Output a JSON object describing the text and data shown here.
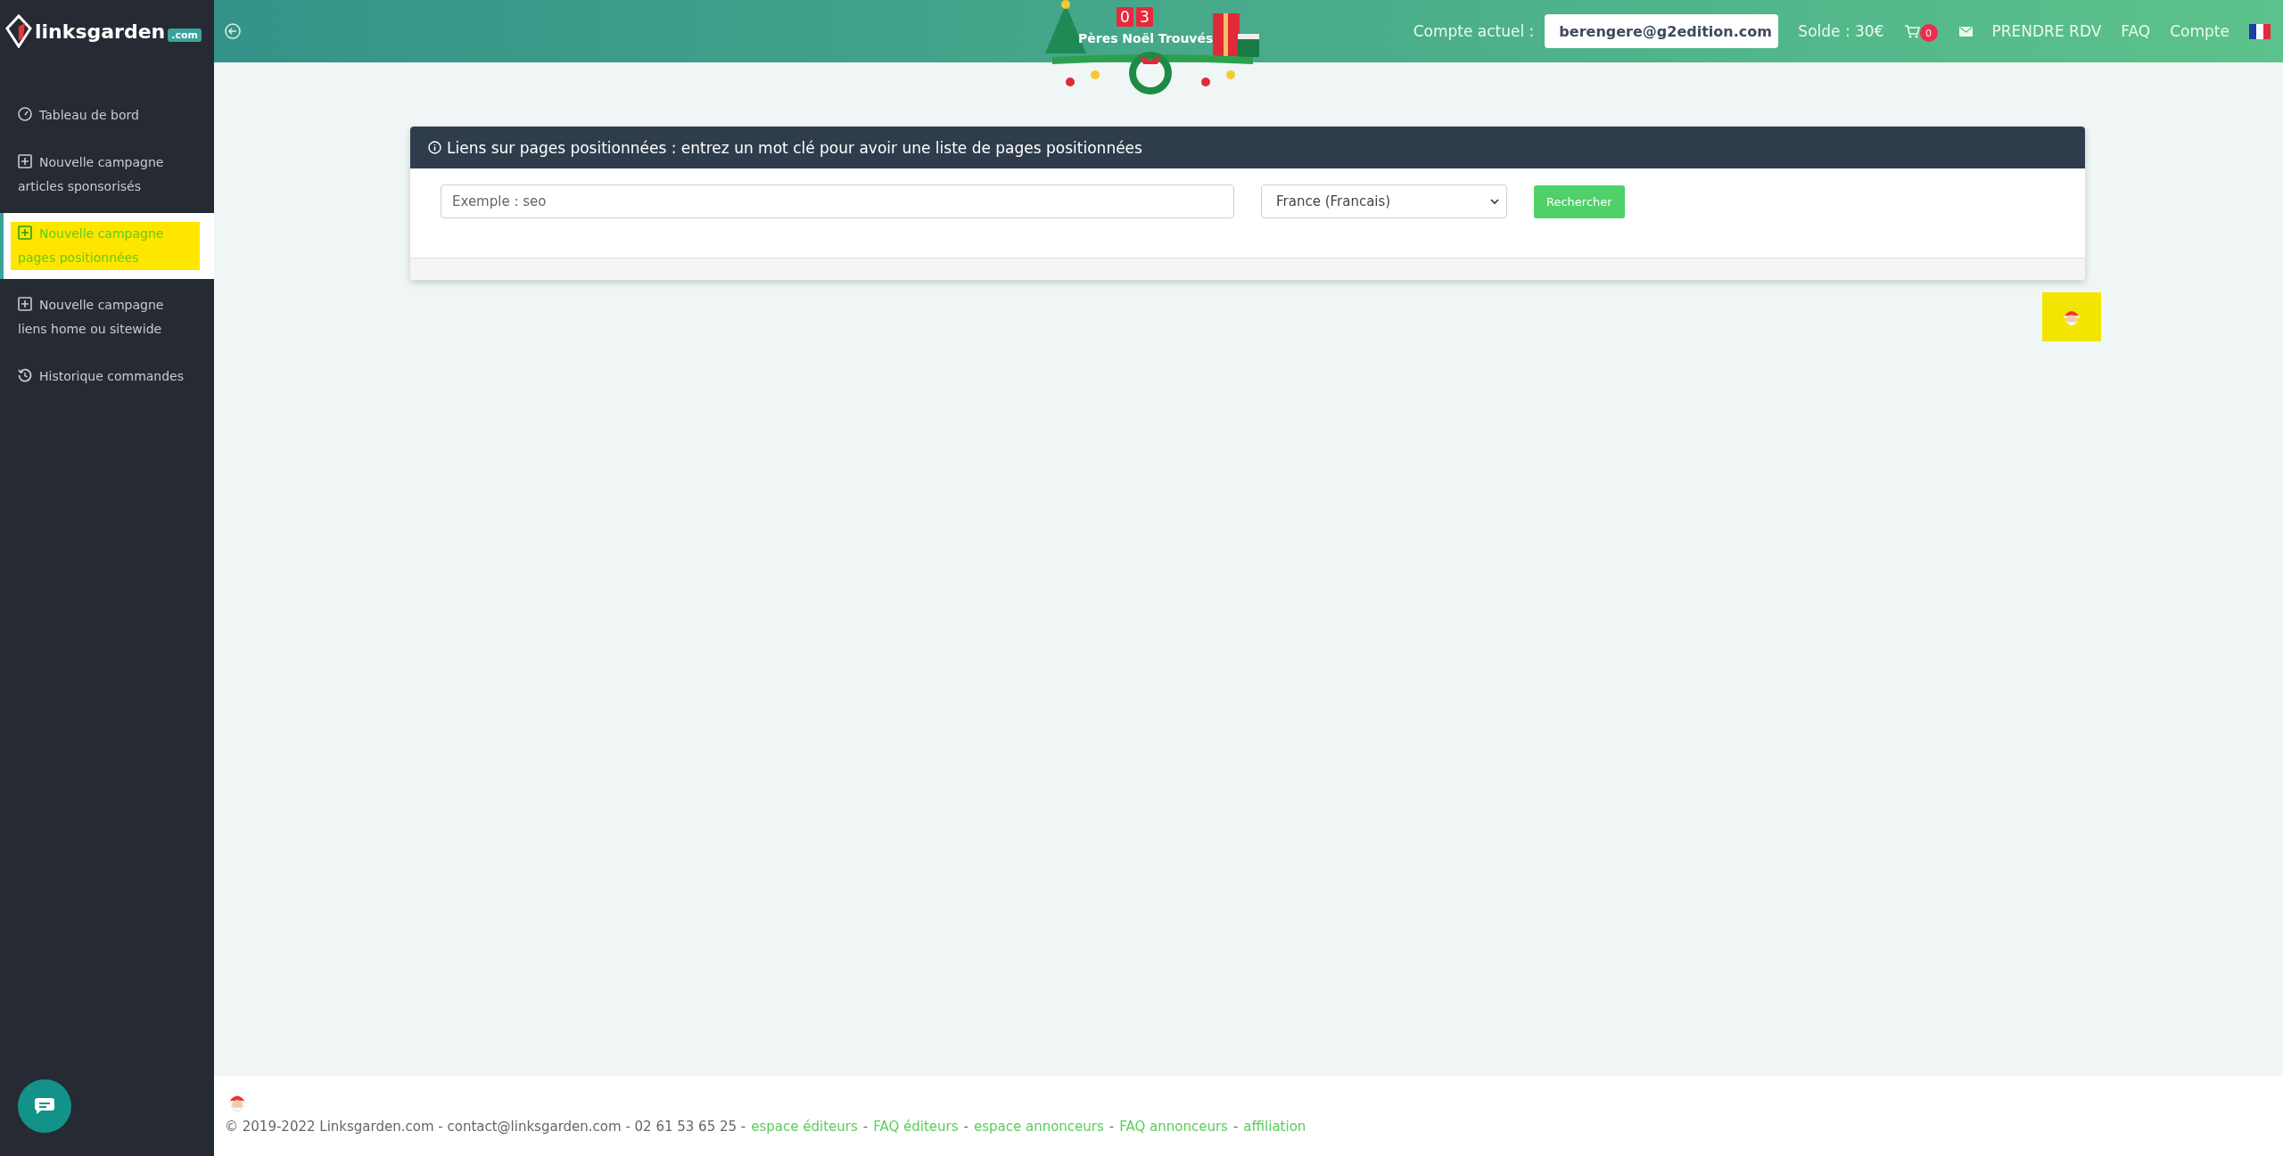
{
  "brand": {
    "name": "linksgarden",
    "tld": ".com"
  },
  "banner": {
    "digits": [
      "0",
      "3"
    ],
    "caption": "Pères Noël Trouvés"
  },
  "header": {
    "account_label": "Compte actuel :",
    "account_value": "berengere@g2edition.com",
    "balance": "Solde : 30€",
    "cart_count": "0",
    "links": [
      "PRENDRE RDV",
      "FAQ",
      "Compte"
    ]
  },
  "sidebar": {
    "items": [
      {
        "kind": "dashboard",
        "lines": [
          "Tableau de bord"
        ],
        "selected": false
      },
      {
        "kind": "create",
        "lines": [
          "Nouvelle campagne",
          "articles sponsorisés"
        ],
        "selected": false
      },
      {
        "kind": "create",
        "lines": [
          "Nouvelle campagne",
          "pages positionnées"
        ],
        "selected": true
      },
      {
        "kind": "create",
        "lines": [
          "Nouvelle campagne",
          "liens home ou sitewide"
        ],
        "selected": false
      },
      {
        "kind": "history",
        "lines": [
          "Historique commandes"
        ],
        "selected": false
      }
    ]
  },
  "card": {
    "title": "Liens sur pages positionnées : entrez un mot clé pour avoir une liste de pages positionnées",
    "keyword": {
      "placeholder": "Exemple : seo"
    },
    "country": "France (Francais)",
    "button": "Rechercher"
  },
  "footer": [
    {
      "kind": "text",
      "text": "© 2019-2022 Linksgarden.com - contact@linksgarden.com - 02 61 53 65 25 -"
    },
    {
      "kind": "link",
      "text": "espace éditeurs"
    },
    {
      "kind": "text",
      "text": "-"
    },
    {
      "kind": "link",
      "text": "FAQ éditeurs"
    },
    {
      "kind": "text",
      "text": "-"
    },
    {
      "kind": "link",
      "text": "espace annonceurs"
    },
    {
      "kind": "text",
      "text": "-"
    },
    {
      "kind": "link",
      "text": "FAQ annonceurs"
    },
    {
      "kind": "text",
      "text": "-"
    },
    {
      "kind": "link",
      "text": "affiliation"
    }
  ]
}
